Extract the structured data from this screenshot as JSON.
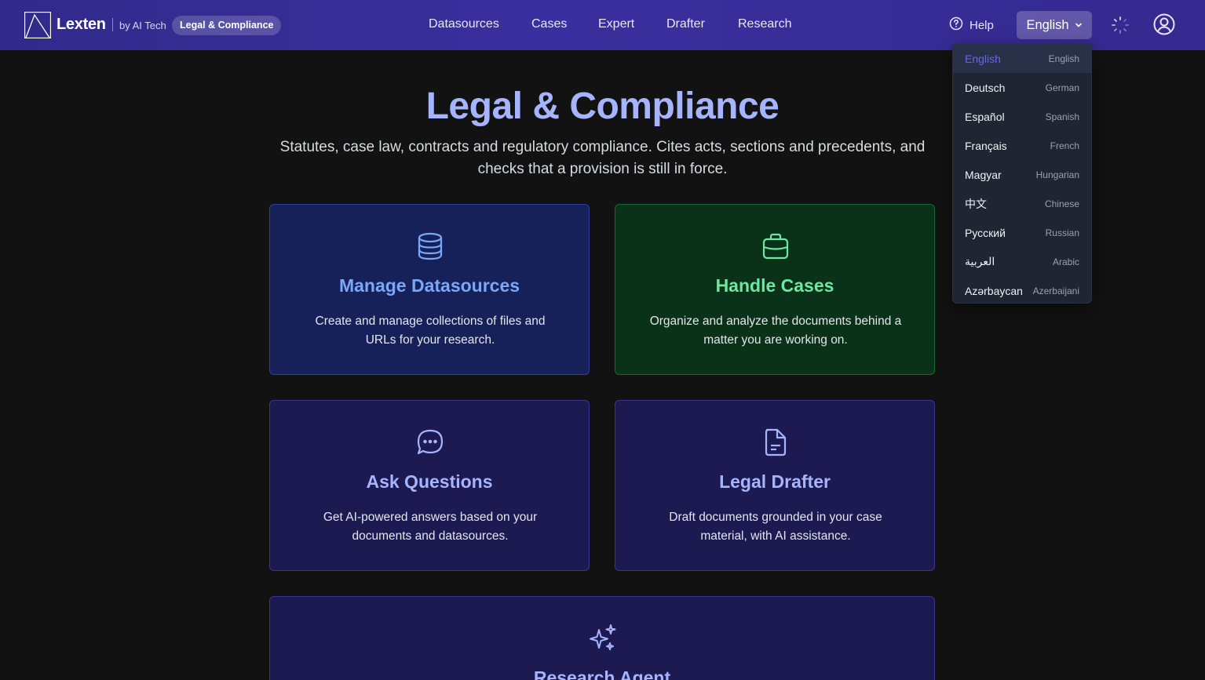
{
  "header": {
    "brand": "Lexten",
    "byline": "by AI Tech",
    "product_badge": "Legal & Compliance",
    "nav": [
      {
        "label": "Datasources"
      },
      {
        "label": "Cases"
      },
      {
        "label": "Expert"
      },
      {
        "label": "Drafter"
      },
      {
        "label": "Research"
      }
    ],
    "help_label": "Help",
    "language_button": "English"
  },
  "language_menu": {
    "selected": "English",
    "options": [
      {
        "native": "English",
        "english": "English"
      },
      {
        "native": "Deutsch",
        "english": "German"
      },
      {
        "native": "Español",
        "english": "Spanish"
      },
      {
        "native": "Français",
        "english": "French"
      },
      {
        "native": "Magyar",
        "english": "Hungarian"
      },
      {
        "native": "中文",
        "english": "Chinese"
      },
      {
        "native": "Русский",
        "english": "Russian"
      },
      {
        "native": "العربية",
        "english": "Arabic"
      },
      {
        "native": "Azərbaycan",
        "english": "Azerbaijani"
      }
    ]
  },
  "hero": {
    "title": "Legal & Compliance",
    "subtitle": "Statutes, case law, contracts and regulatory compliance. Cites acts, sections and precedents, and checks that a provision is still in force."
  },
  "cards": [
    {
      "title": "Manage Datasources",
      "description": "Create and manage collections of files and URLs for your research.",
      "icon": "database-icon"
    },
    {
      "title": "Handle Cases",
      "description": "Organize and analyze the documents behind a matter you are working on.",
      "icon": "briefcase-icon"
    },
    {
      "title": "Ask Questions",
      "description": "Get AI-powered answers based on your documents and datasources.",
      "icon": "chat-bubble-icon"
    },
    {
      "title": "Legal Drafter",
      "description": "Draft documents grounded in your case material, with AI assistance.",
      "icon": "document-icon"
    },
    {
      "title": "Research Agent",
      "description": "",
      "icon": "sparkles-icon"
    }
  ],
  "colors": {
    "header_bg": "#352b95",
    "page_bg": "#121212",
    "accent_indigo": "#6366f1",
    "title_lavender": "#a5b4fc",
    "card_blue": "#172159",
    "card_green": "#0a3219",
    "card_purple": "#1d1a52"
  }
}
